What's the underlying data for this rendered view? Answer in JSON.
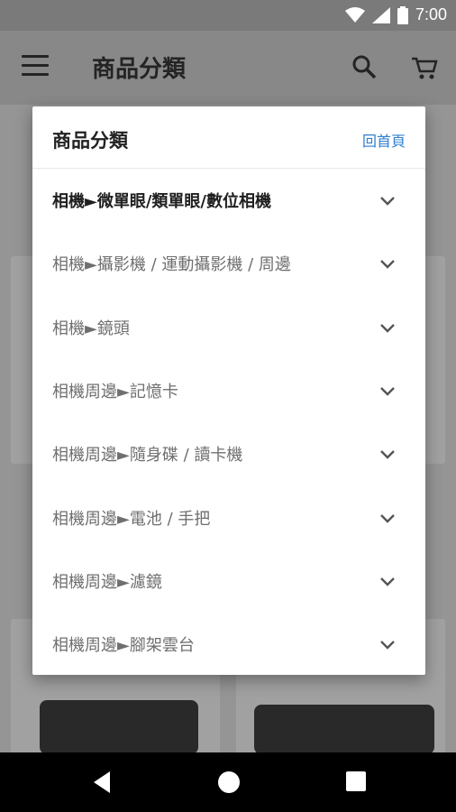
{
  "status": {
    "time": "7:00"
  },
  "app_bar": {
    "title": "商品分類"
  },
  "dialog": {
    "title": "商品分類",
    "home_link": "回首頁",
    "categories": [
      {
        "label": "相機►微單眼/類單眼/數位相機",
        "active": true
      },
      {
        "label": "相機►攝影機 / 運動攝影機 / 周邊"
      },
      {
        "label": "相機►鏡頭"
      },
      {
        "label": "相機周邊►記憶卡"
      },
      {
        "label": "相機周邊►隨身碟 / 讀卡機"
      },
      {
        "label": "相機周邊►電池 / 手把"
      },
      {
        "label": "相機周邊►濾鏡"
      },
      {
        "label": "相機周邊►腳架雲台"
      }
    ]
  },
  "colors": {
    "accent": "#2f7fd0",
    "price_red": "#a13a2e"
  }
}
